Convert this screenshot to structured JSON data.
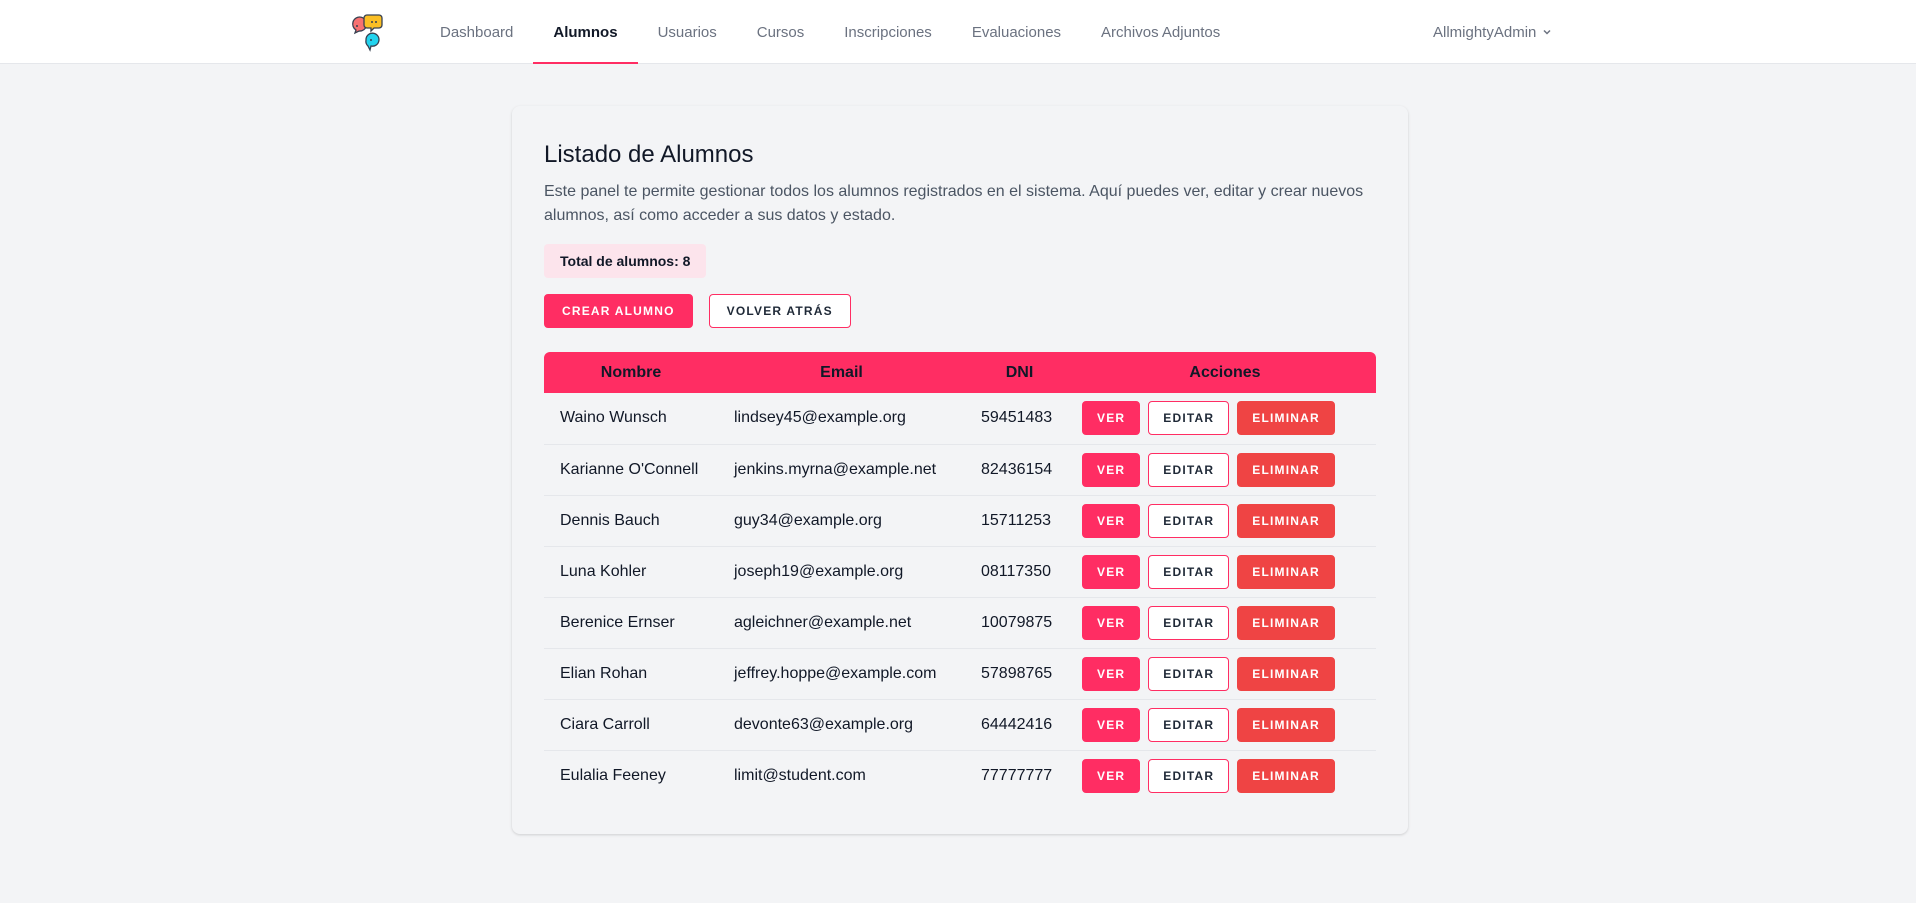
{
  "nav": {
    "items": [
      {
        "label": "Dashboard",
        "active": false
      },
      {
        "label": "Alumnos",
        "active": true
      },
      {
        "label": "Usuarios",
        "active": false
      },
      {
        "label": "Cursos",
        "active": false
      },
      {
        "label": "Inscripciones",
        "active": false
      },
      {
        "label": "Evaluaciones",
        "active": false
      },
      {
        "label": "Archivos Adjuntos",
        "active": false
      }
    ],
    "user": "AllmightyAdmin",
    "accent": "#ff2d63"
  },
  "page": {
    "title": "Listado de Alumnos",
    "description": "Este panel te permite gestionar todos los alumnos registrados en el sistema. Aquí puedes ver, editar y crear nuevos alumnos, así como acceder a sus datos y estado.",
    "total_label": "Total de alumnos: 8",
    "create_button": "Crear Alumno",
    "back_button": "Volver Atrás"
  },
  "table": {
    "headers": [
      "Nombre",
      "Email",
      "DNI",
      "Acciones"
    ],
    "action_labels": {
      "view": "Ver",
      "edit": "Editar",
      "delete": "Eliminar"
    },
    "rows": [
      {
        "name": "Waino Wunsch",
        "email": "lindsey45@example.org",
        "dni": "59451483"
      },
      {
        "name": "Karianne O'Connell",
        "email": "jenkins.myrna@example.net",
        "dni": "82436154"
      },
      {
        "name": "Dennis Bauch",
        "email": "guy34@example.org",
        "dni": "15711253"
      },
      {
        "name": "Luna Kohler",
        "email": "joseph19@example.org",
        "dni": "08117350"
      },
      {
        "name": "Berenice Ernser",
        "email": "agleichner@example.net",
        "dni": "10079875"
      },
      {
        "name": "Elian Rohan",
        "email": "jeffrey.hoppe@example.com",
        "dni": "57898765"
      },
      {
        "name": "Ciara Carroll",
        "email": "devonte63@example.org",
        "dni": "64442416"
      },
      {
        "name": "Eulalia Feeney",
        "email": "limit@student.com",
        "dni": "77777777"
      }
    ]
  },
  "colors": {
    "primary": "#ff2d63",
    "danger": "#ef4444",
    "badge_bg": "#fce4ec",
    "background": "#f3f4f6"
  }
}
